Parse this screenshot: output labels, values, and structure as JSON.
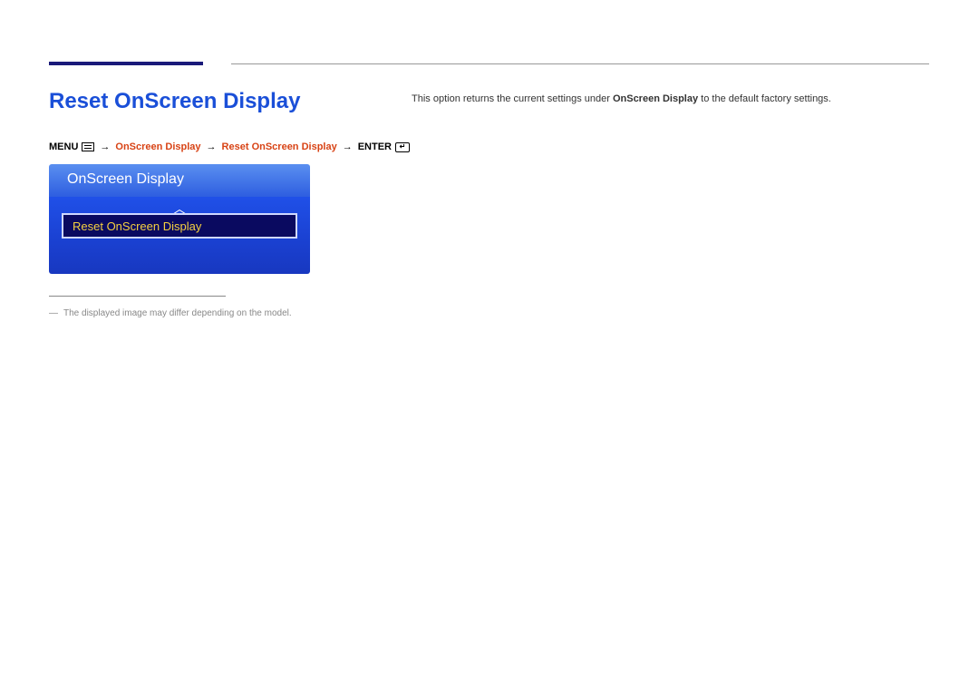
{
  "page": {
    "title": "Reset OnScreen Display"
  },
  "description": {
    "pre": "This option returns the current settings under ",
    "bold": "OnScreen Display",
    "post": " to the default factory settings."
  },
  "breadcrumb": {
    "menu_label": "MENU",
    "arrow": "→",
    "crumb1": "OnScreen Display",
    "crumb2": "Reset OnScreen Display",
    "enter_label": "ENTER"
  },
  "osd": {
    "header": "OnScreen Display",
    "item": "Reset OnScreen Display"
  },
  "footnote": {
    "text": "The displayed image may differ depending on the model."
  }
}
